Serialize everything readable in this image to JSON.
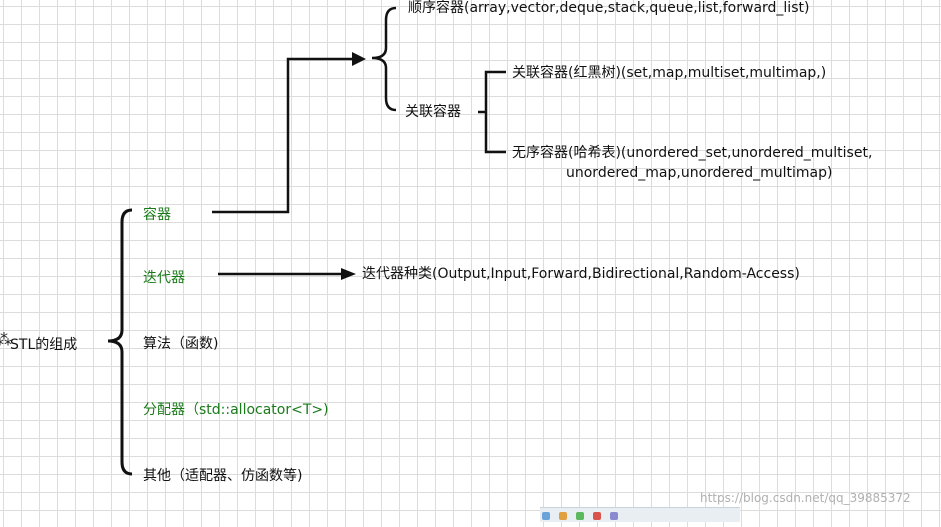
{
  "root": {
    "label": "STL的组成"
  },
  "components": [
    {
      "label": "容器",
      "highlight": true
    },
    {
      "label": "迭代器",
      "highlight": true
    },
    {
      "label": "算法（函数)",
      "highlight": false
    },
    {
      "label": "分配器（std::allocator<T>)",
      "highlight": true
    },
    {
      "label": "其他（适配器、仿函数等)",
      "highlight": false
    }
  ],
  "containers": {
    "sequence": "顺序容器(array,vector,deque,stack,queue,list,forward_list)",
    "associative": "关联容器",
    "ordered": "关联容器(红黑树)(set,map,multiset,multimap,)",
    "unordered_line1": "无序容器(哈希表)(unordered_set,unordered_multiset,",
    "unordered_line2": "unordered_map,unordered_multimap)"
  },
  "iterators": {
    "kinds": "迭代器种类(Output,Input,Forward,Bidirectional,Random-Access)"
  },
  "watermark": "https://blog.csdn.net/qq_39885372",
  "colors": {
    "highlight": "#1a7a1a",
    "line": "#111111",
    "grid": "#dcdcdc"
  }
}
